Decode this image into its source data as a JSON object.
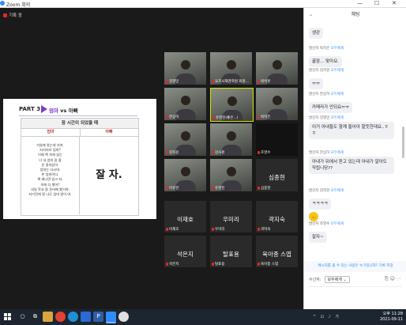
{
  "window": {
    "title": "Zoom 회의",
    "min": "—",
    "max": "☐",
    "close": "✕"
  },
  "meeting": {
    "recording_label": "기록 중",
    "slide": {
      "part": "PART 3",
      "vs_left": "엄마",
      "vs_mid": " vs ",
      "vs_right": "아빠",
      "table_title": "잠 시간이 되었을 때",
      "col1_header": "엄마",
      "col2_header": "아빠",
      "col1_lines": [
        "거실에 왔는데 지켜.",
        "지저지러 엄마?",
        "이제 책 속에 읽는",
        "너 내 엄마 잠 올",
        "준 잘자있어.",
        "엄마는 다시마.",
        "손 엄마이다.",
        "책 재니면 읽고 자.",
        "속에 다 떨어?",
        "내일 학교 잘 준비해 봤거야.",
        "자기전에 잘 나무 엄마 말이 야."
      ],
      "col2_text": "잘 자."
    },
    "tiles": [
      {
        "name": "김영민",
        "kind": "video"
      },
      {
        "name": "요즈시재경학원 회원...",
        "kind": "video"
      },
      {
        "name": "박석훈",
        "kind": "video"
      },
      {
        "name": "한상하",
        "kind": "video"
      },
      {
        "name": "유현진(좋은...)",
        "kind": "video"
      },
      {
        "name": "박지은",
        "kind": "video"
      },
      {
        "name": "김지윤",
        "kind": "video"
      },
      {
        "name": "강사원",
        "kind": "video"
      },
      {
        "name": "조영수",
        "kind": "dark"
      },
      {
        "name": "이유한",
        "kind": "video"
      },
      {
        "name": "유현진",
        "kind": "video"
      },
      {
        "name": "심종현",
        "kind": "name",
        "label": "심종현"
      },
      {
        "name": "이재호",
        "kind": "name",
        "label": "이재호"
      },
      {
        "name": "우미리",
        "kind": "name",
        "label": "우미리"
      },
      {
        "name": "곽지숙",
        "kind": "name",
        "label": "곽지숙"
      },
      {
        "name": "석은지",
        "kind": "name",
        "label": "석은지"
      },
      {
        "name": "탈표용",
        "kind": "name",
        "label": "탈표용"
      },
      {
        "name": "육아종 스엽",
        "kind": "name",
        "label": "육아종 스엽"
      }
    ]
  },
  "chat": {
    "title": "채팅",
    "messages": [
      {
        "sender": "",
        "to": "",
        "text": "생강"
      },
      {
        "sender": "발신자 박지은",
        "to": "모두에게",
        "text": "꿀잠... 맞아요."
      },
      {
        "sender": "발신자 김지현",
        "to": "모두에게",
        "text": "ㅠㅠ"
      },
      {
        "sender": "발신자 한상하",
        "to": "모두에게",
        "text": "카메라가 안되요ㅠㅠ"
      },
      {
        "sender": "발신자 김영민",
        "to": "모두에게",
        "text": "이거 아내들도 함께 들어야 할듯한데요..ㅎㅎ"
      },
      {
        "sender": "발신자 한상하",
        "to": "모두에게",
        "text": "아내가 뒤에서 듣고 있는데 아내가 알아도 작됩니당??"
      },
      {
        "sender": "발신자 김지현",
        "to": "모두에게",
        "text": "ㅋㅋㅋㅋ"
      },
      {
        "sender": "",
        "to": "",
        "text": "emoji"
      },
      {
        "sender": "발신자 조영수",
        "to": "모두에게",
        "text": "잘자~"
      }
    ],
    "receiver_notice": "메시지를 볼 수 있는 사람은 누구입니까? 기록 저장",
    "to_label": "수신자:",
    "to_value": "모두에게",
    "input_icons": "⎘ ☺ ⋯"
  },
  "taskbar": {
    "time": "오후 11:28",
    "date": "2021-09-11",
    "tray": "^ ⊡ ♪ 가"
  }
}
